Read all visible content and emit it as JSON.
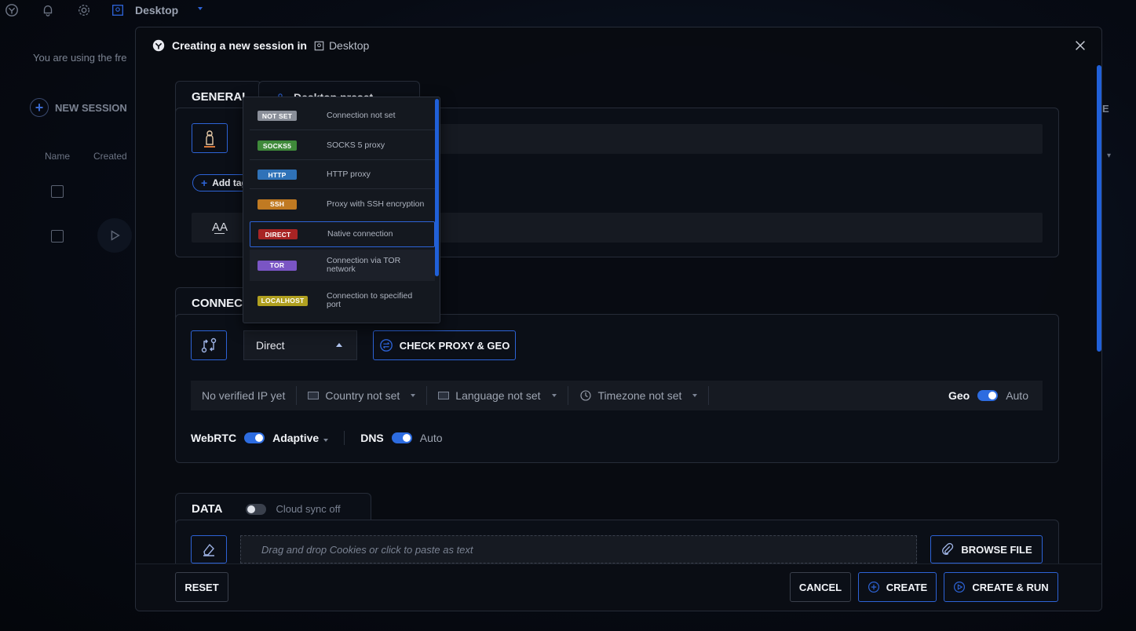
{
  "topbar": {
    "title": "Desktop"
  },
  "background": {
    "notice": "You are using the fre",
    "new_session": "NEW SESSION",
    "col_name": "Name",
    "col_created": "Created",
    "right_letter": "E"
  },
  "modal": {
    "title": "Creating a new session in",
    "workspace": "Desktop",
    "general": {
      "title": "GENERAL",
      "preset_label": "Desktop preset",
      "add_tag": "Add tag"
    },
    "connection": {
      "title": "CONNECTION",
      "proxy_type": "Direct",
      "check_button": "CHECK PROXY & GEO",
      "ip": "No verified IP yet",
      "country": "Country not set",
      "language": "Language not set",
      "timezone": "Timezone not set",
      "geo_label": "Geo",
      "geo_value": "Auto",
      "webrtc_label": "WebRTC",
      "webrtc_value": "Adaptive",
      "dns_label": "DNS",
      "dns_value": "Auto"
    },
    "data": {
      "title": "DATA",
      "cloud_sync": "Cloud sync off",
      "dropzone_placeholder": "Drag and drop Cookies or click to paste as text",
      "browse_button": "BROWSE FILE"
    },
    "footer": {
      "reset": "RESET",
      "cancel": "CANCEL",
      "create": "CREATE",
      "create_run": "CREATE & RUN"
    }
  },
  "proxy_dropdown": {
    "items": [
      {
        "badge": "NOT SET",
        "desc": "Connection not set",
        "color": "#8a8f99"
      },
      {
        "badge": "SOCKS5",
        "desc": "SOCKS 5 proxy",
        "color": "#3f8a3a"
      },
      {
        "badge": "HTTP",
        "desc": "HTTP proxy",
        "color": "#2f72b8"
      },
      {
        "badge": "SSH",
        "desc": "Proxy with SSH encryption",
        "color": "#c07a22"
      },
      {
        "badge": "DIRECT",
        "desc": "Native connection",
        "color": "#a82424"
      },
      {
        "badge": "TOR",
        "desc": "Connection via TOR network",
        "color": "#7a55c4"
      },
      {
        "badge": "LOCALHOST",
        "desc": "Connection to specified port",
        "color": "#b0a020"
      }
    ]
  },
  "colors": {
    "accent": "#2d63d6",
    "scrollbar": "#2060d8"
  }
}
